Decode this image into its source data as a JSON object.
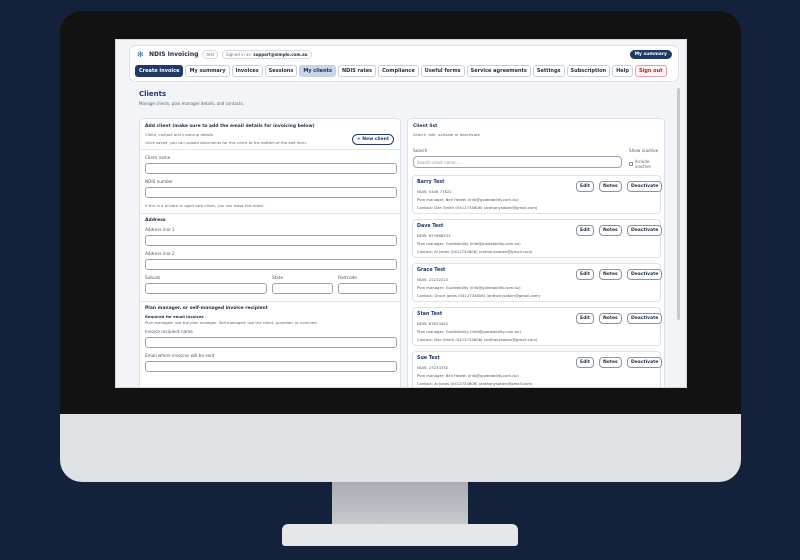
{
  "app": {
    "name": "NDIS Invoicing",
    "badge": "test",
    "signed_in_label": "Signed in as",
    "signed_in_email": "support@simplo.com.au",
    "summary_button": "My summary"
  },
  "nav": [
    "Create invoice",
    "My summary",
    "Invoices",
    "Sessions",
    "My clients",
    "NDIS rates",
    "Compliance",
    "Useful forms",
    "Service agreements",
    "Settings",
    "Subscription",
    "Help",
    "Sign out"
  ],
  "page": {
    "title": "Clients",
    "subtitle": "Manage clients, plan manager details, and contacts."
  },
  "add_client": {
    "heading": "Add client (make sure to add the email details for invoicing below)",
    "sub1": "Client, contact and invoicing details",
    "sub2": "Once saved, you can upload documents for this client at the bottom of the edit form.",
    "new_button": "+ New client",
    "client_name_label": "Client name",
    "ndis_label": "NDIS number",
    "ndis_help": "If this is a private or aged care client, you can leave this blank.",
    "address_heading": "Address",
    "address1_label": "Address line 1",
    "address2_label": "Address line 2",
    "suburb_label": "Suburb",
    "state_label": "State",
    "postcode_label": "Postcode",
    "pm_heading": "Plan manager, or self-managed invoice recipient",
    "pm_required": "Required for email invoices",
    "pm_help": "Plan-managed: use the plan manager. Self-managed: use the client, guardian, or nominee.",
    "recipient_label": "Invoice recipient name",
    "email_label": "Email where invoices will be sent"
  },
  "client_list": {
    "heading": "Client list",
    "sub": "Search, edit, activate or deactivate",
    "search_label": "Search",
    "search_placeholder": "Search client name...",
    "show_inactive_label": "Show inactive",
    "include_inactive": "Include inactive",
    "buttons": {
      "edit": "Edit",
      "notes": "Notes",
      "deactivate": "Deactivate"
    },
    "clients": [
      {
        "name": "Barry Test",
        "ndis": "NDIS: 5446 77822",
        "pm": "Plan manager: Bell Health (info@guideability.com.au)",
        "contact": "Contact: Dan Smith (0412734608) (anthonysaben@gmail.com)"
      },
      {
        "name": "Dave Test",
        "ndis": "NDIS: 657666533",
        "pm": "Plan manager: Guideability (info@guideability.com.au)",
        "contact": "Contact: Al Jones (0412734608) (anthonysaben@gmail.com)"
      },
      {
        "name": "Grace Test",
        "ndis": "NDIS: 22222222",
        "pm": "Plan manager: Guideability (info@guideability.com.au)",
        "contact": "Contact: Grace Jones (0412734608) (anthonysaben@gmail.com)"
      },
      {
        "name": "Stan Test",
        "ndis": "NDIS: 63553442",
        "pm": "Plan manager: GuideAbility (info@guideability.com.au)",
        "contact": "Contact: Dan Smith (0412734608) (anthonysaben@gmail.com)"
      },
      {
        "name": "Sue Test",
        "ndis": "NDIS: 23233332",
        "pm": "Plan manager: Bell Health (info@guideability.com.au)",
        "contact": "Contact: Al Jones (0412734608) (anthonysaben@gmail.com)"
      }
    ]
  }
}
